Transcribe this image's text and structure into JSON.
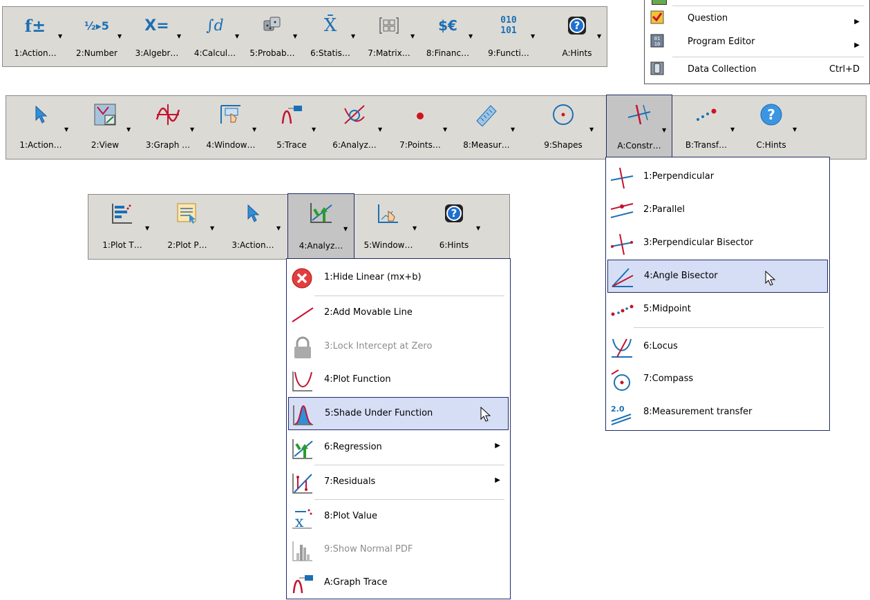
{
  "toolbar_a": {
    "items": [
      {
        "icon": "f±",
        "label": "1:Action…"
      },
      {
        "icon": "½▸5",
        "label": "2:Number"
      },
      {
        "icon": "X=",
        "label": "3:Algebr…"
      },
      {
        "icon": "∫d",
        "label": "4:Calcul…"
      },
      {
        "icon": "dice",
        "label": "5:Probab…"
      },
      {
        "icon": "X̄",
        "label": "6:Statis…"
      },
      {
        "icon": "matrix",
        "label": "7:Matrix…"
      },
      {
        "icon": "$€",
        "label": "8:Financ…"
      },
      {
        "icon": "010 101",
        "label": "9:Functi…"
      },
      {
        "icon": "?",
        "label": "A:Hints"
      }
    ]
  },
  "general_menu": {
    "items": [
      {
        "label": "Question",
        "shortcut": "",
        "submenu": true
      },
      {
        "label": "Program Editor",
        "shortcut": "",
        "submenu": true
      },
      {
        "label": "Data Collection",
        "shortcut": "Ctrl+D",
        "submenu": false
      }
    ]
  },
  "toolbar_b": {
    "items": [
      {
        "label": "1:Action…"
      },
      {
        "label": "2:View"
      },
      {
        "label": "3:Graph …"
      },
      {
        "label": "4:Window…"
      },
      {
        "label": "5:Trace"
      },
      {
        "label": "6:Analyz…"
      },
      {
        "label": "7:Points…"
      },
      {
        "label": "8:Measur…"
      },
      {
        "label": "9:Shapes"
      },
      {
        "label": "A:Constr…"
      },
      {
        "label": "B:Transf…"
      },
      {
        "label": "C:Hints"
      }
    ]
  },
  "construct_menu": {
    "items": [
      {
        "label": "1:Perpendicular"
      },
      {
        "label": "2:Parallel"
      },
      {
        "label": "3:Perpendicular Bisector"
      },
      {
        "label": "4:Angle Bisector"
      },
      {
        "label": "5:Midpoint"
      },
      {
        "label": "6:Locus"
      },
      {
        "label": "7:Compass"
      },
      {
        "label": "8:Measurement transfer"
      }
    ]
  },
  "toolbar_c": {
    "items": [
      {
        "label": "1:Plot T…"
      },
      {
        "label": "2:Plot P…"
      },
      {
        "label": "3:Action…"
      },
      {
        "label": "4:Analyz…"
      },
      {
        "label": "5:Window…"
      },
      {
        "label": "6:Hints"
      }
    ]
  },
  "analyze_menu": {
    "items": [
      {
        "label": "1:Hide Linear (mx+b)",
        "disabled": false,
        "submenu": false
      },
      {
        "label": "2:Add Movable Line",
        "disabled": false,
        "submenu": false
      },
      {
        "label": "3:Lock Intercept at Zero",
        "disabled": true,
        "submenu": false
      },
      {
        "label": "4:Plot Function",
        "disabled": false,
        "submenu": false
      },
      {
        "label": "5:Shade Under Function",
        "disabled": false,
        "submenu": false
      },
      {
        "label": "6:Regression",
        "disabled": false,
        "submenu": true
      },
      {
        "label": "7:Residuals",
        "disabled": false,
        "submenu": true
      },
      {
        "label": "8:Plot Value",
        "disabled": false,
        "submenu": false
      },
      {
        "label": "9:Show Normal PDF",
        "disabled": true,
        "submenu": false
      },
      {
        "label": "A:Graph Trace",
        "disabled": false,
        "submenu": false
      }
    ]
  },
  "colors": {
    "toolbar_bg": "#dcdad5",
    "menu_border": "#1f2a66",
    "highlight": "#d6def5",
    "icon_blue": "#1a6fb5",
    "icon_red": "#c4122f"
  }
}
